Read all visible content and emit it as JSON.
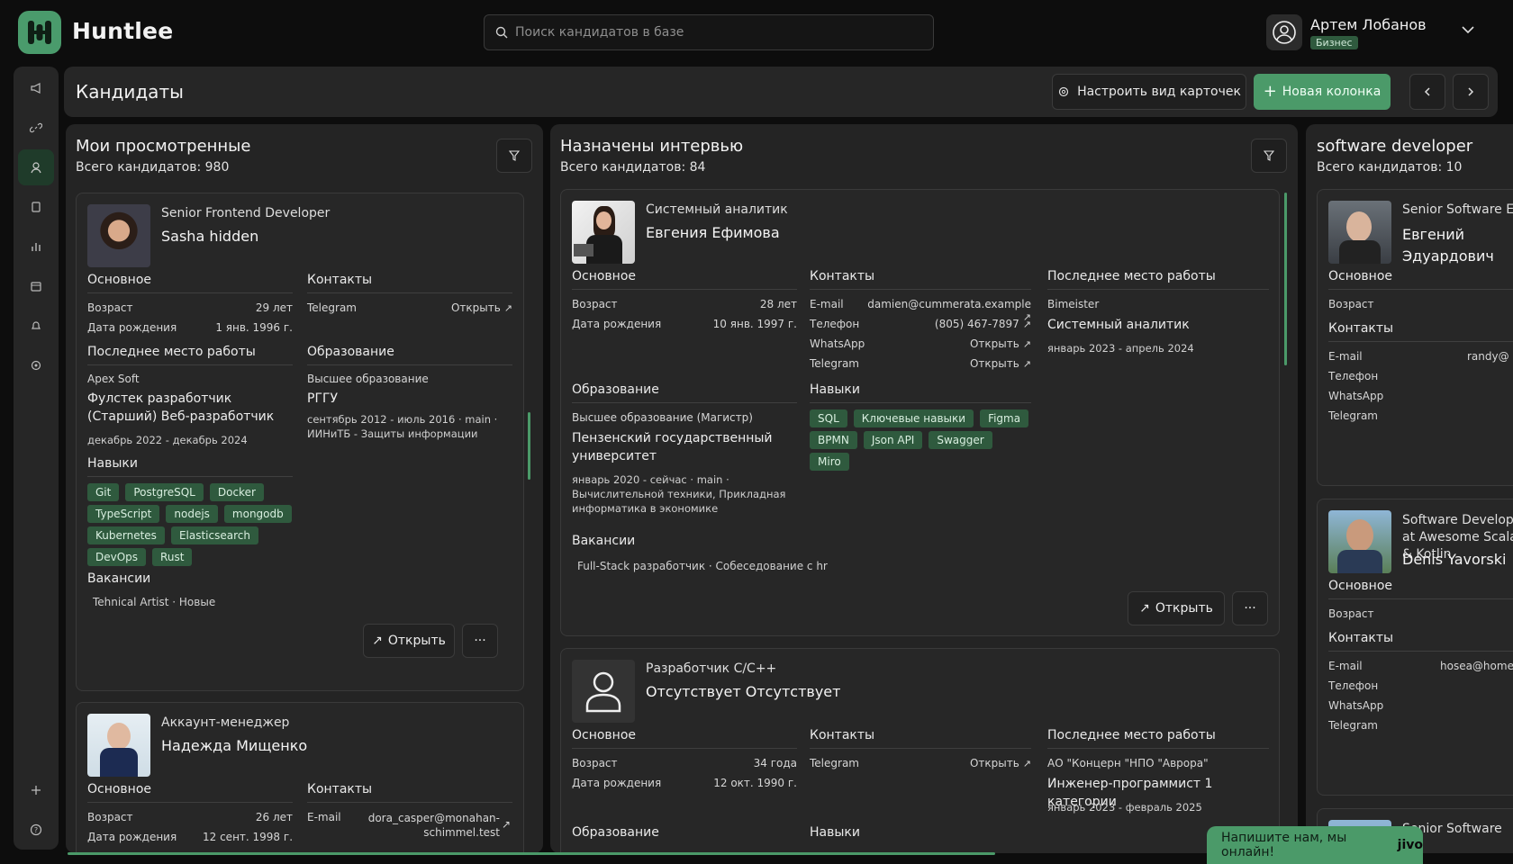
{
  "app": {
    "name": "Huntlee"
  },
  "search": {
    "placeholder": "Поиск кандидатов в базе"
  },
  "user": {
    "name": "Артем Лобанов",
    "plan": "Бизнес"
  },
  "page": {
    "title": "Кандидаты",
    "configure_label": "Настроить вид карточек",
    "new_column_label": "Новая колонка"
  },
  "common": {
    "main": "Основное",
    "contacts": "Контакты",
    "last_job": "Последнее место работы",
    "education": "Образование",
    "skills": "Навыки",
    "vacancies": "Вакансии",
    "age": "Возраст",
    "dob": "Дата рождения",
    "email": "E-mail",
    "phone": "Телефон",
    "whatsapp": "WhatsApp",
    "telegram": "Telegram",
    "open": "Открыть",
    "open_btn": "Открыть",
    "more": "···"
  },
  "columns": [
    {
      "title": "Мои просмотренные",
      "count": "Всего кандидатов: 980",
      "cards": [
        {
          "role": "Senior Frontend Developer",
          "name": "Sasha hidden",
          "age": "29 лет",
          "dob": "1 янв. 1996 г.",
          "company": "Apex Soft",
          "position": "Фулстек разработчик (Старший) Веб-разработчик",
          "job_period": "декабрь 2022 - декабрь 2024",
          "edu_level": "Высшее образование",
          "edu_school": "РГГУ",
          "edu_details": "сентябрь 2012 - июль 2016 · main · ИИНиТБ - Защиты информации",
          "skills": [
            "Git",
            "PostgreSQL",
            "Docker",
            "TypeScript",
            "nodejs",
            "mongodb",
            "Kubernetes",
            "Elasticsearch",
            "DevOps",
            "Rust"
          ],
          "vacancy": "Tehnical Artist · Новые"
        },
        {
          "role": "Аккаунт-менеджер",
          "name": "Надежда Мищенко",
          "age": "26 лет",
          "dob": "12 сент. 1998 г.",
          "email": "dora_casper@monahan-schimmel.test"
        }
      ]
    },
    {
      "title": "Назначены интервью",
      "count": "Всего кандидатов: 84",
      "cards": [
        {
          "role": "Системный аналитик",
          "name": "Евгения Ефимова",
          "age": "28 лет",
          "dob": "10 янв. 1997 г.",
          "email": "damien@cummerata.example",
          "phone": "(805) 467-7897",
          "company": "Bimeister",
          "position": "Системный аналитик",
          "job_period": "январь 2023 - апрель 2024",
          "edu_level": "Высшее образование (Магистр)",
          "edu_school": "Пензенский государственный университет",
          "edu_details": "январь 2020 - сейчас · main · Вычислительной техники, Прикладная информатика в экономике",
          "skills": [
            "SQL",
            "Ключевые навыки",
            "Figma",
            "BPMN",
            "Json API",
            "Swagger",
            "Miro"
          ],
          "vacancy": "Full-Stack разработчик · Собеседование с hr"
        },
        {
          "role": "Разработчик C/C++",
          "name": "Отсутствует Отсутствует",
          "age": "34 года",
          "dob": "12 окт. 1990 г.",
          "company": "АО \"Концерн \"НПО \"Аврора\"",
          "position": "Инженер-программист 1 категории",
          "job_period": "январь 2023 - февраль 2025"
        }
      ]
    },
    {
      "title": "software developer",
      "count": "Всего кандидатов: 10",
      "cards": [
        {
          "role": "Senior Software Engineer",
          "name": "Евгений Эдуардович",
          "email": "randy@"
        },
        {
          "role": "Software Developer at Awesome Scala & Kotlin",
          "name": "Denis Yavorski",
          "email": "hosea@homenic"
        },
        {
          "role": "Senior Software"
        }
      ]
    }
  ],
  "chat": {
    "text": "Напишите нам, мы онлайн!",
    "brand": "jivo"
  },
  "colors": {
    "accent": "#4b9a69",
    "tag_bg": "#2f5a3e",
    "bg": "#0d0d0d",
    "panel": "#242424"
  }
}
